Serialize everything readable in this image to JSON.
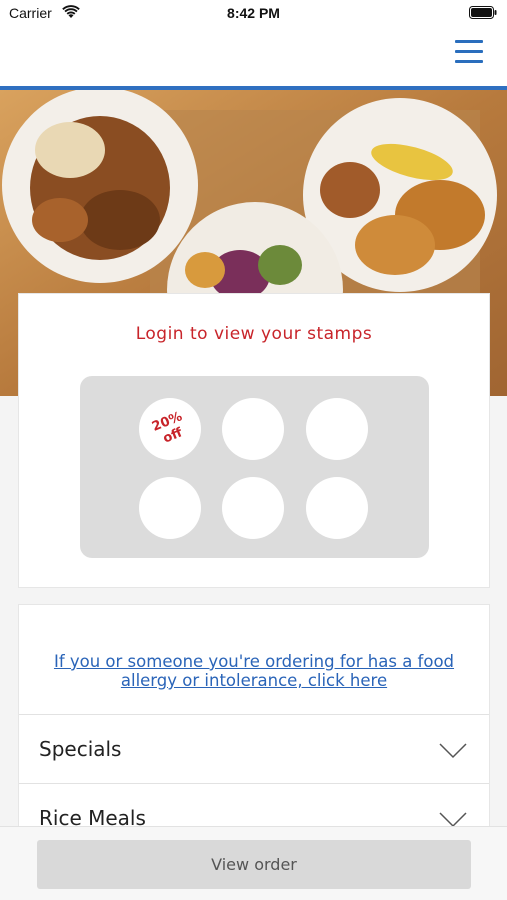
{
  "status_bar": {
    "carrier": "Carrier",
    "time": "8:42 PM",
    "wifi_icon": "wifi-icon",
    "battery_icon": "battery-icon"
  },
  "nav": {
    "menu_icon": "hamburger-menu-icon",
    "accent_color": "#2f6fc0"
  },
  "hero": {
    "image": "food-plates-photo"
  },
  "stamps": {
    "title": "Login to view your stamps",
    "title_color": "#c8242a",
    "reward_label": "20%\noff",
    "stamp_count": 6
  },
  "menu": {
    "allergy_link": "If you or someone you're ordering for has a food allergy or intolerance, click here",
    "link_color": "#2a64b8",
    "categories": [
      {
        "label": "Specials",
        "icon": "chevron-down-icon"
      },
      {
        "label": "Rice Meals",
        "icon": "chevron-down-icon"
      }
    ]
  },
  "footer": {
    "view_order_label": "View order"
  }
}
